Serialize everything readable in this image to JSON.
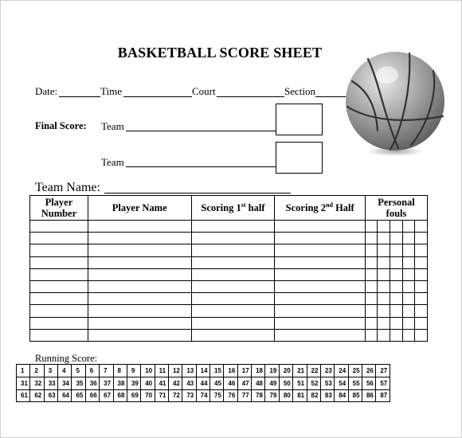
{
  "title": "BASKETBALL SCORE SHEET",
  "info_line": {
    "date_label": "Date:",
    "time_label": "Time",
    "court_label": "Court",
    "section_label": "Section"
  },
  "final_score": {
    "label": "Final Score:",
    "team1_label": "Team",
    "team2_label": "Team"
  },
  "team_name_label": "Team Name:",
  "table": {
    "headers": {
      "player_number_line1": "Player",
      "player_number_line2": "Number",
      "player_name": "Player Name",
      "scoring_1st_prefix": "Scoring 1",
      "scoring_1st_sup": "st",
      "scoring_1st_suffix": " half",
      "scoring_2nd_prefix": "Scoring 2",
      "scoring_2nd_sup": "nd",
      "scoring_2nd_suffix": " Half",
      "fouls_line1": "Personal",
      "fouls_line2": "fouls"
    },
    "row_count": 10,
    "foul_columns": 5
  },
  "running_score": {
    "label": "Running Score:",
    "rows": [
      [
        "1",
        "2",
        "3",
        "4",
        "5",
        "6",
        "7",
        "8",
        "9",
        "10",
        "11",
        "12",
        "13",
        "14",
        "15",
        "16",
        "17",
        "18",
        "19",
        "20",
        "21",
        "22",
        "23",
        "24",
        "25",
        "26",
        "27"
      ],
      [
        "31",
        "32",
        "33",
        "34",
        "35",
        "36",
        "37",
        "38",
        "39",
        "40",
        "41",
        "42",
        "43",
        "44",
        "45",
        "46",
        "47",
        "48",
        "49",
        "50",
        "51",
        "52",
        "53",
        "54",
        "55",
        "56",
        "57"
      ],
      [
        "61",
        "62",
        "63",
        "64",
        "65",
        "66",
        "67",
        "68",
        "69",
        "70",
        "71",
        "72",
        "73",
        "74",
        "75",
        "76",
        "77",
        "78",
        "79",
        "80",
        "81",
        "82",
        "83",
        "84",
        "85",
        "86",
        "87"
      ]
    ]
  },
  "illustration": "basketball-icon"
}
